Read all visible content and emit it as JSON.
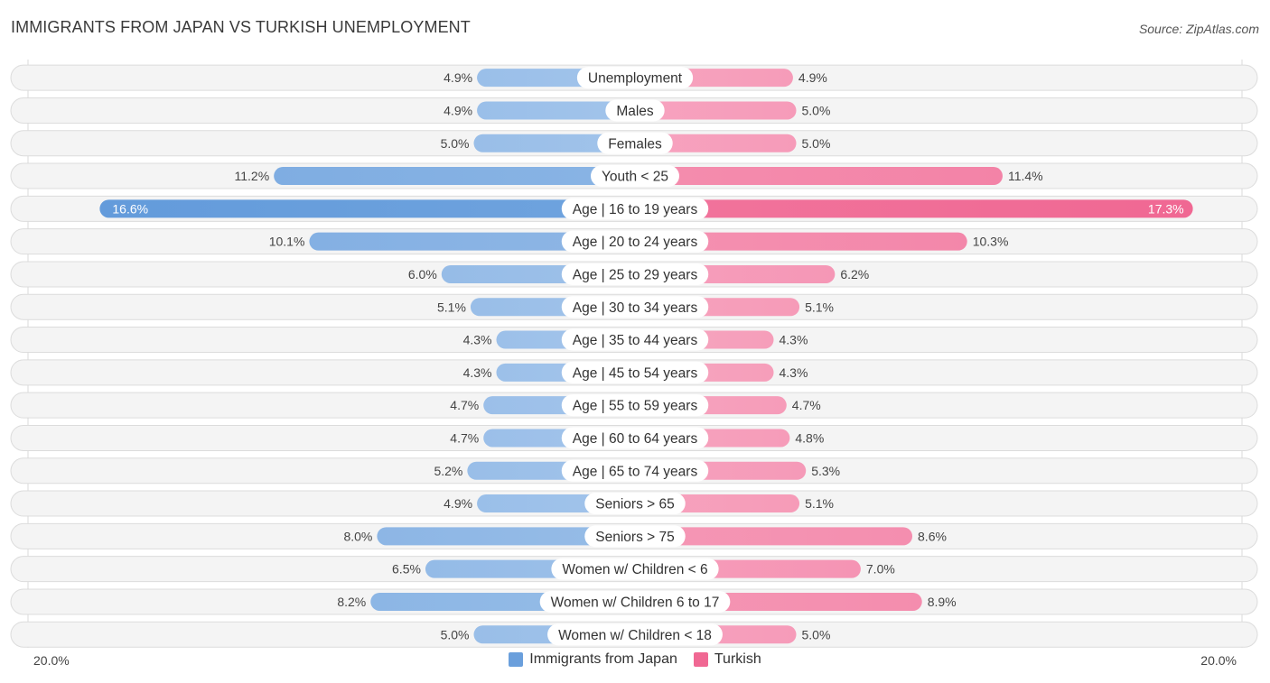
{
  "header": {
    "title": "IMMIGRANTS FROM JAPAN VS TURKISH UNEMPLOYMENT",
    "source": "Source: ZipAtlas.com"
  },
  "axis": {
    "left_label": "20.0%",
    "right_label": "20.0%"
  },
  "legend": {
    "items": [
      {
        "label": "Immigrants from Japan",
        "color": "#6a9fdc"
      },
      {
        "label": "Turkish",
        "color": "#f06893"
      }
    ]
  },
  "colors": {
    "left_light": "#a8c8ec",
    "left_strong": "#5f98da",
    "right_light": "#f7a8c2",
    "right_strong": "#f06893"
  },
  "chart_data": {
    "type": "bar",
    "orientation": "horizontal-diverging",
    "title": "IMMIGRANTS FROM JAPAN VS TURKISH UNEMPLOYMENT",
    "xlabel": "",
    "ylabel": "",
    "xlim": [
      -20,
      20
    ],
    "unit": "%",
    "legend_position": "bottom-center",
    "categories": [
      "Unemployment",
      "Males",
      "Females",
      "Youth < 25",
      "Age | 16 to 19 years",
      "Age | 20 to 24 years",
      "Age | 25 to 29 years",
      "Age | 30 to 34 years",
      "Age | 35 to 44 years",
      "Age | 45 to 54 years",
      "Age | 55 to 59 years",
      "Age | 60 to 64 years",
      "Age | 65 to 74 years",
      "Seniors > 65",
      "Seniors > 75",
      "Women w/ Children < 6",
      "Women w/ Children 6 to 17",
      "Women w/ Children < 18"
    ],
    "series": [
      {
        "name": "Immigrants from Japan",
        "side": "left",
        "values": [
          4.9,
          4.9,
          5.0,
          11.2,
          16.6,
          10.1,
          6.0,
          5.1,
          4.3,
          4.3,
          4.7,
          4.7,
          5.2,
          4.9,
          8.0,
          6.5,
          8.2,
          5.0
        ],
        "labels": [
          "4.9%",
          "4.9%",
          "5.0%",
          "11.2%",
          "16.6%",
          "10.1%",
          "6.0%",
          "5.1%",
          "4.3%",
          "4.3%",
          "4.7%",
          "4.7%",
          "5.2%",
          "4.9%",
          "8.0%",
          "6.5%",
          "8.2%",
          "5.0%"
        ]
      },
      {
        "name": "Turkish",
        "side": "right",
        "values": [
          4.9,
          5.0,
          5.0,
          11.4,
          17.3,
          10.3,
          6.2,
          5.1,
          4.3,
          4.3,
          4.7,
          4.8,
          5.3,
          5.1,
          8.6,
          7.0,
          8.9,
          5.0
        ],
        "labels": [
          "4.9%",
          "5.0%",
          "5.0%",
          "11.4%",
          "17.3%",
          "10.3%",
          "6.2%",
          "5.1%",
          "4.3%",
          "4.3%",
          "4.7%",
          "4.8%",
          "5.3%",
          "5.1%",
          "8.6%",
          "7.0%",
          "8.9%",
          "5.0%"
        ]
      }
    ]
  }
}
